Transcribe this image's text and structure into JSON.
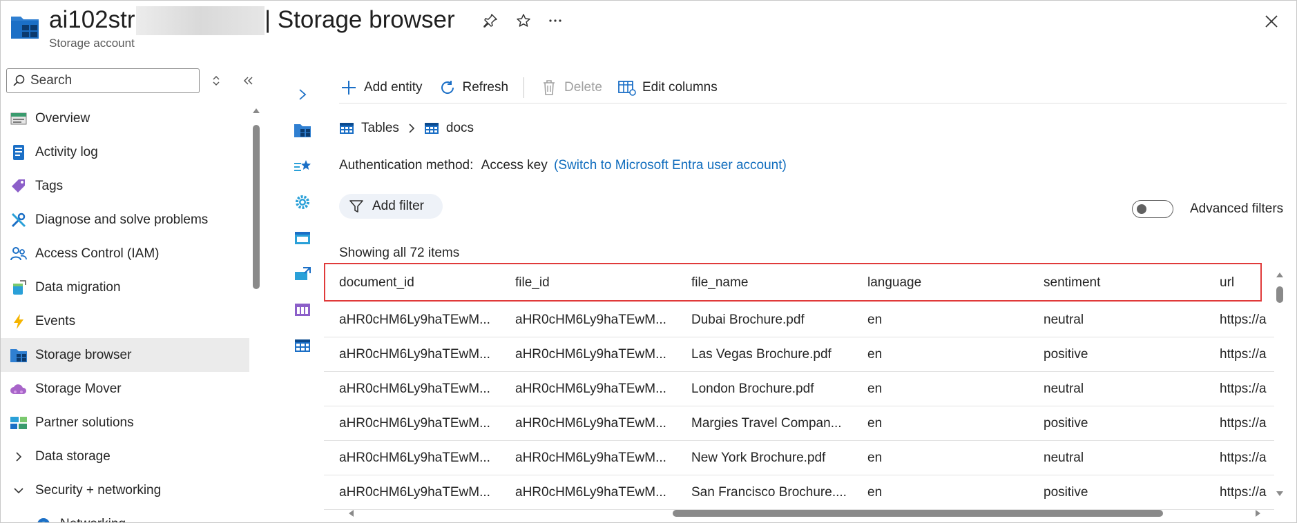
{
  "header": {
    "title_prefix": "ai102str",
    "title_suffix": "| Storage browser",
    "subtitle": "Storage account"
  },
  "sidebar": {
    "search_placeholder": "Search",
    "items": [
      {
        "label": "Overview",
        "icon": "overview-icon"
      },
      {
        "label": "Activity log",
        "icon": "activity-log-icon"
      },
      {
        "label": "Tags",
        "icon": "tag-icon"
      },
      {
        "label": "Diagnose and solve problems",
        "icon": "wrench-icon"
      },
      {
        "label": "Access Control (IAM)",
        "icon": "people-icon"
      },
      {
        "label": "Data migration",
        "icon": "data-migration-icon"
      },
      {
        "label": "Events",
        "icon": "lightning-icon"
      },
      {
        "label": "Storage browser",
        "icon": "storage-browser-icon",
        "active": true
      },
      {
        "label": "Storage Mover",
        "icon": "cloud-icon"
      },
      {
        "label": "Partner solutions",
        "icon": "partner-icon"
      },
      {
        "label": "Data storage",
        "icon": "chevron-right-icon",
        "group": true
      },
      {
        "label": "Security + networking",
        "icon": "chevron-down-icon",
        "group": true
      },
      {
        "label": "Networking",
        "icon": "networking-icon",
        "sub": true
      }
    ]
  },
  "toolbar": {
    "add_entity": "Add entity",
    "refresh": "Refresh",
    "delete": "Delete",
    "edit_columns": "Edit columns"
  },
  "breadcrumb": {
    "root": "Tables",
    "current": "docs"
  },
  "auth": {
    "label": "Authentication method:",
    "value": "Access key",
    "link": "(Switch to Microsoft Entra user account)"
  },
  "filter": {
    "add_filter": "Add filter",
    "advanced_filters": "Advanced filters"
  },
  "table": {
    "count_text": "Showing all 72 items",
    "columns": [
      "document_id",
      "file_id",
      "file_name",
      "language",
      "sentiment",
      "url"
    ],
    "rows": [
      [
        "aHR0cHM6Ly9haTEwM...",
        "aHR0cHM6Ly9haTEwM...",
        "Dubai Brochure.pdf",
        "en",
        "neutral",
        "https://a"
      ],
      [
        "aHR0cHM6Ly9haTEwM...",
        "aHR0cHM6Ly9haTEwM...",
        "Las Vegas Brochure.pdf",
        "en",
        "positive",
        "https://a"
      ],
      [
        "aHR0cHM6Ly9haTEwM...",
        "aHR0cHM6Ly9haTEwM...",
        "London Brochure.pdf",
        "en",
        "neutral",
        "https://a"
      ],
      [
        "aHR0cHM6Ly9haTEwM...",
        "aHR0cHM6Ly9haTEwM...",
        "Margies Travel Compan...",
        "en",
        "positive",
        "https://a"
      ],
      [
        "aHR0cHM6Ly9haTEwM...",
        "aHR0cHM6Ly9haTEwM...",
        "New York Brochure.pdf",
        "en",
        "neutral",
        "https://a"
      ],
      [
        "aHR0cHM6Ly9haTEwM...",
        "aHR0cHM6Ly9haTEwM...",
        "San Francisco Brochure....",
        "en",
        "positive",
        "https://a"
      ]
    ]
  },
  "colors": {
    "link": "#0f6cbd",
    "highlight": "#e03a3a",
    "active_nav": "#ebebeb"
  }
}
